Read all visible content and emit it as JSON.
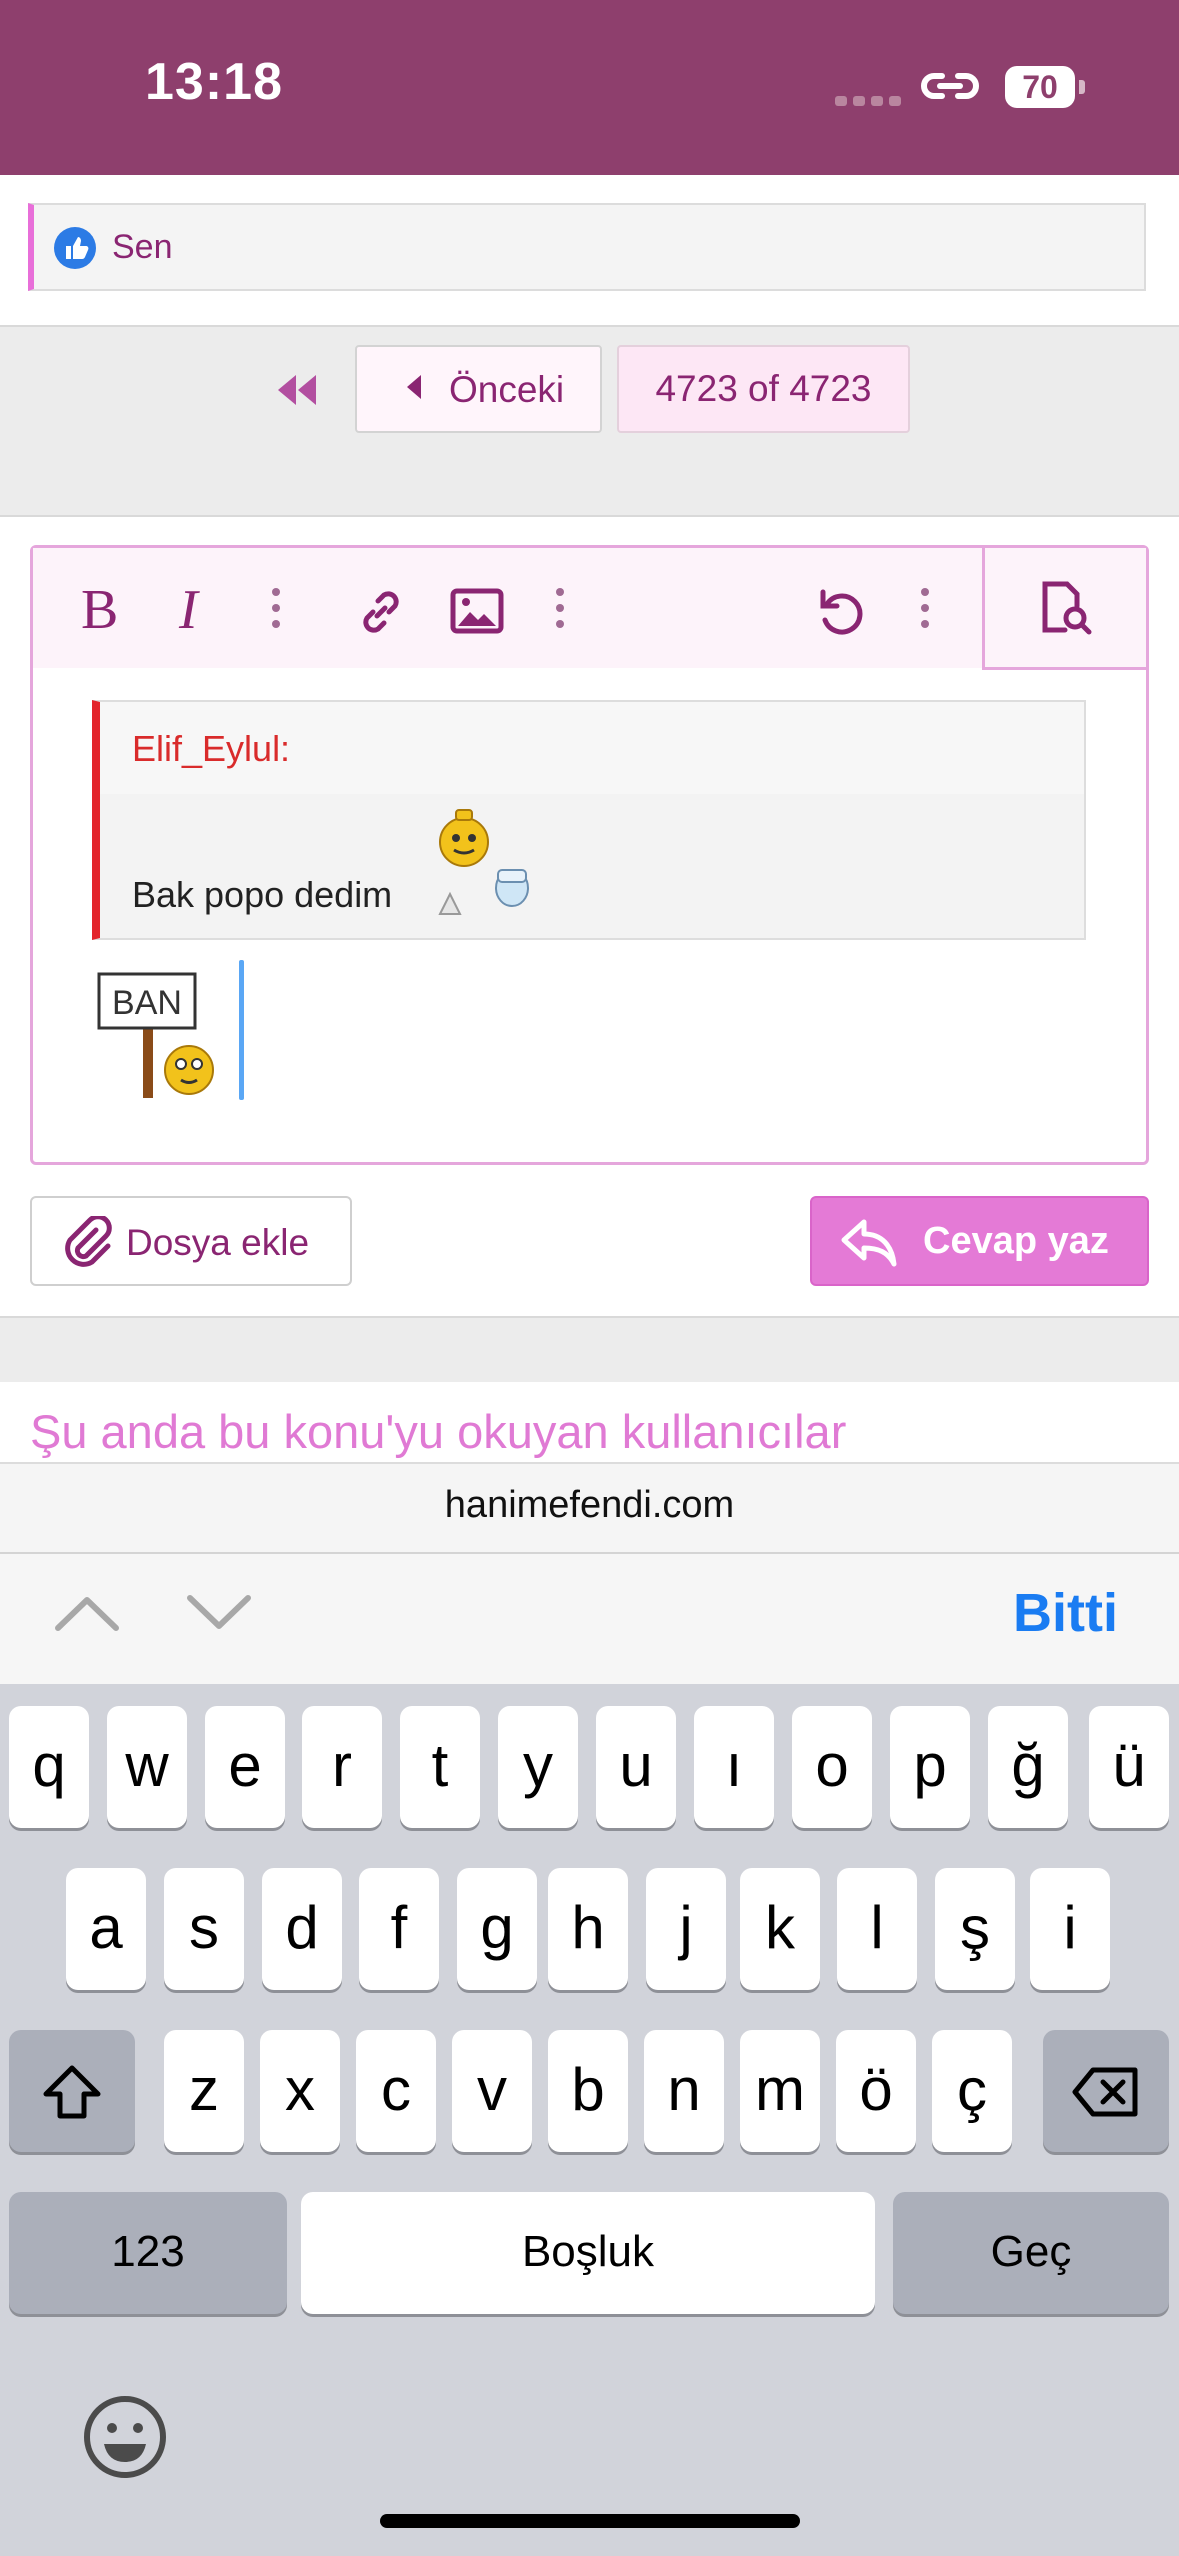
{
  "status_bar": {
    "time": "13:18",
    "battery": "70"
  },
  "likes": {
    "text": "Sen"
  },
  "pagination": {
    "prev_label": "Önceki",
    "page_indicator": "4723 of 4723"
  },
  "editor": {
    "toolbar": [
      "bold-button",
      "italic-button",
      "more-text-options",
      "link-button",
      "image-button",
      "more-insert-options",
      "undo-button",
      "more-options",
      "preview-button"
    ],
    "quote_author": "Elif_Eylul:",
    "quote_body": "Bak popo dedim",
    "ban_sign_text": "BAN"
  },
  "actions": {
    "attach_label": "Dosya ekle",
    "reply_label": "Cevap yaz"
  },
  "readers_heading": "Şu anda bu konu'yu okuyan kullanıcılar",
  "browser": {
    "domain": "hanimefendi.com"
  },
  "accessory": {
    "done_label": "Bitti"
  },
  "keyboard": {
    "row1": [
      "q",
      "w",
      "e",
      "r",
      "t",
      "y",
      "u",
      "ı",
      "o",
      "p",
      "ğ",
      "ü"
    ],
    "row2": [
      "a",
      "s",
      "d",
      "f",
      "g",
      "h",
      "j",
      "k",
      "l",
      "ş",
      "i"
    ],
    "row3": [
      "z",
      "x",
      "c",
      "v",
      "b",
      "n",
      "m",
      "ö",
      "ç"
    ],
    "numbers_label": "123",
    "space_label": "Boşluk",
    "return_label": "Geç"
  },
  "colors": {
    "brand": "#8e3f6d",
    "accent": "#e47ad6",
    "link": "#8a2572",
    "done": "#1a7cf2"
  }
}
